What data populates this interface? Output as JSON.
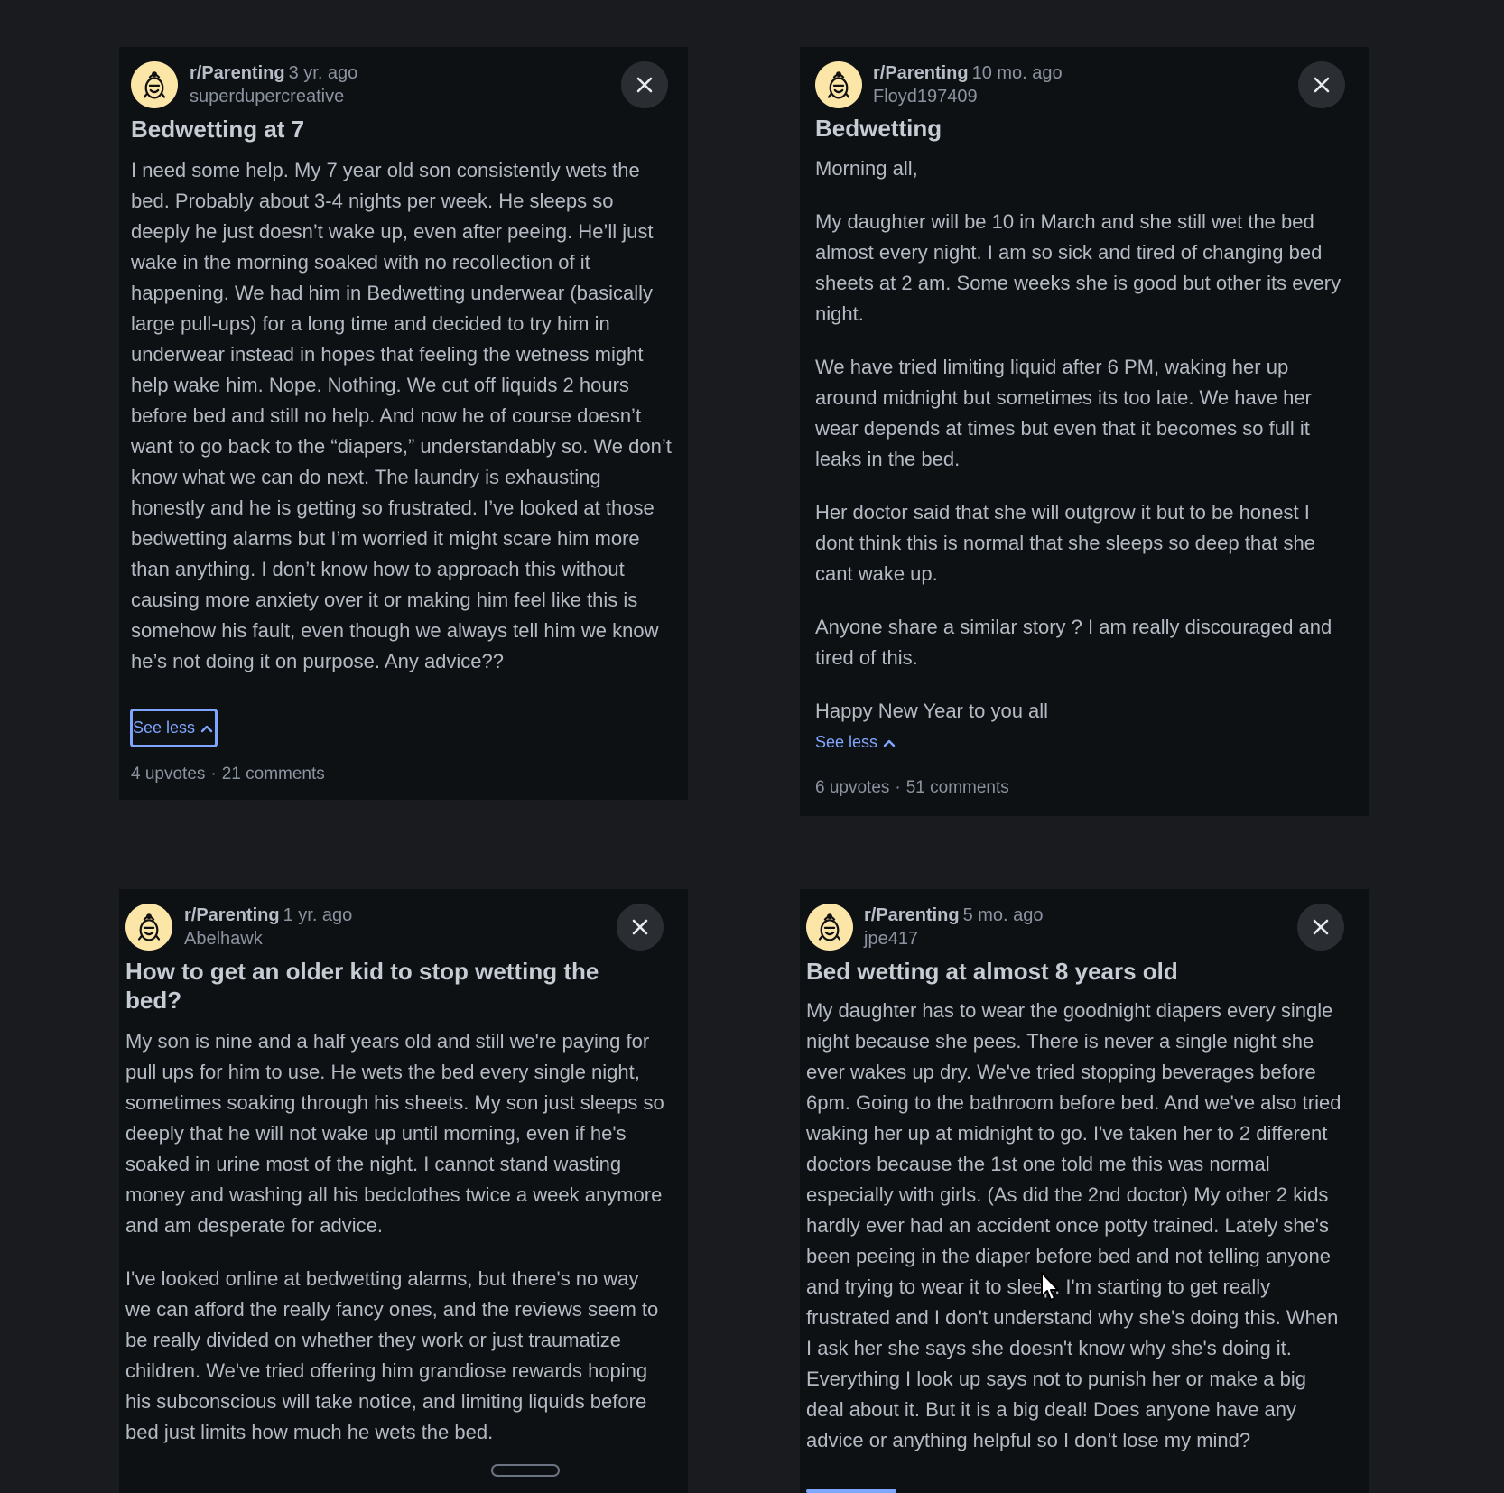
{
  "posts": [
    {
      "subreddit": "r/Parenting",
      "age": "3 yr. ago",
      "author": "superdupercreative",
      "title": "Bedwetting at 7",
      "paragraphs": [
        "I need some help. My 7 year old son consistently wets the bed. Probably about 3-4 nights per week. He sleeps so deeply he just doesn’t wake up, even after peeing. He’ll just wake in the morning soaked with no recollection of it happening. We had him in Bedwetting underwear (basically large pull-ups) for a long time and decided to try him in underwear instead in hopes that feeling the wetness might help wake him. Nope. Nothing. We cut off liquids 2 hours before bed and still no help. And now he of course doesn’t want to go back to the “diapers,” understandably so. We don’t know what we can do next. The laundry is exhausting honestly and he is getting so frustrated. I’ve looked at those bedwetting alarms but I’m worried it might scare him more than anything. I don’t know how to approach this without causing more anxiety over it or making him feel like this is somehow his fault, even though we always tell him we know he’s not doing it on purpose. Any advice??"
      ],
      "see_less": "See less",
      "upvotes": "4 upvotes",
      "comments": "21 comments"
    },
    {
      "subreddit": "r/Parenting",
      "age": "10 mo. ago",
      "author": "Floyd197409",
      "title": "Bedwetting",
      "paragraphs": [
        "Morning all,",
        "My daughter will be 10 in March and she still wet the bed almost every night. I am so sick and tired of changing bed sheets at 2 am. Some weeks she is good but other its every night.",
        "We have tried limiting liquid after 6 PM, waking her up around midnight but sometimes its too late. We have her wear depends at times but even that it becomes so full it leaks in the bed.",
        "Her doctor said that she will outgrow it but to be honest I dont think this is normal that she sleeps so deep that she cant wake up.",
        "Anyone share a similar story ? I am really discouraged and tired of this.",
        "Happy New Year to you all"
      ],
      "see_less": "See less",
      "upvotes": "6 upvotes",
      "comments": "51 comments"
    },
    {
      "subreddit": "r/Parenting",
      "age": "1 yr. ago",
      "author": "Abelhawk",
      "title": "How to get an older kid to stop wetting the bed?",
      "paragraphs": [
        "My son is nine and a half years old and still we're paying for pull ups for him to use. He wets the bed every single night, sometimes soaking through his sheets. My son just sleeps so deeply that he will not wake up until morning, even if he's soaked in urine most of the night. I cannot stand wasting money and washing all his bedclothes twice a week anymore and am desperate for advice.",
        "I've looked online at bedwetting alarms, but there's no way we can afford the really fancy ones, and the reviews seem to be really divided on whether they work or just traumatize children. We've tried offering him grandiose rewards hoping his subconscious will take notice, and limiting liquids before bed just limits how much he wets the bed."
      ]
    },
    {
      "subreddit": "r/Parenting",
      "age": "5 mo. ago",
      "author": "jpe417",
      "title": "Bed wetting at almost 8 years old",
      "paragraphs": [
        "My daughter has to wear the goodnight diapers every single night because she pees. There is never a single night she ever wakes up dry. We've tried stopping beverages before 6pm. Going to the bathroom before bed. And we've also tried waking her up at midnight to go. I've taken her to 2 different doctors because the 1st one told me this was normal especially with girls. (As did the 2nd doctor) My other 2 kids hardly ever had an accident once potty trained. Lately she's been peeing in the diaper before bed and not telling anyone and trying to wear it to sleep. I'm starting to get really frustrated and I don't understand why she's doing this. When I ask her she says she doesn't know why she's doing it. Everything I look up says not to punish her or make a big deal about it. But it is a big deal! Does anyone have any advice or anything helpful so I don't lose my mind?"
      ]
    }
  ],
  "stats_separator": "·",
  "icons": {
    "avatar": "snoo-parenting-icon",
    "close": "close-icon",
    "chevron": "chevron-up-icon",
    "cursor": "mouse-cursor-icon"
  },
  "colors": {
    "background": "#1a1b1e",
    "card": "#0e1114",
    "avatar_bg": "#fbe6a8",
    "link": "#7fa6ff",
    "muted": "#8b93a0"
  }
}
